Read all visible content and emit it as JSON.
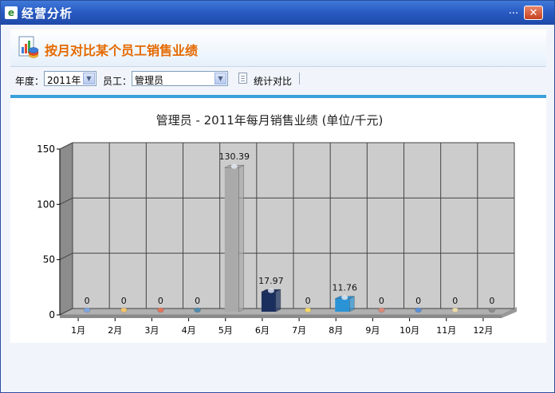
{
  "window": {
    "title": "经营分析",
    "min_glyph": "...",
    "close_glyph": "✕"
  },
  "header": {
    "title": "按月对比某个员工销售业绩"
  },
  "toolbar": {
    "year_label": "年度：",
    "year_value": "2011年",
    "employee_label": "员工：",
    "employee_value": "管理员",
    "compare_button": "统计对比"
  },
  "chart_data": {
    "type": "bar",
    "title": "管理员 - 2011年每月销售业绩 (单位/千元)",
    "categories": [
      "1月",
      "2月",
      "3月",
      "4月",
      "5月",
      "6月",
      "7月",
      "8月",
      "9月",
      "10月",
      "11月",
      "12月"
    ],
    "values": [
      0,
      0,
      0,
      0,
      130.39,
      17.97,
      0,
      11.76,
      0,
      0,
      0,
      0
    ],
    "value_labels": [
      "0",
      "0",
      "0",
      "0",
      "130.39",
      "17.97",
      "0",
      "11.76",
      "0",
      "0",
      "0",
      "0"
    ],
    "colors": [
      "#7ea6e0",
      "#f2c46d",
      "#e2745a",
      "#4f8ab0",
      "#aaaaaa",
      "#1a2f5e",
      "#f4d96b",
      "#2a93d6",
      "#d98a7a",
      "#5b8fd6",
      "#ead9a8",
      "#8c8c8c"
    ],
    "ylim": [
      0,
      150
    ],
    "yticks": [
      0,
      50,
      100,
      150
    ],
    "grid": true,
    "three_d": true
  }
}
